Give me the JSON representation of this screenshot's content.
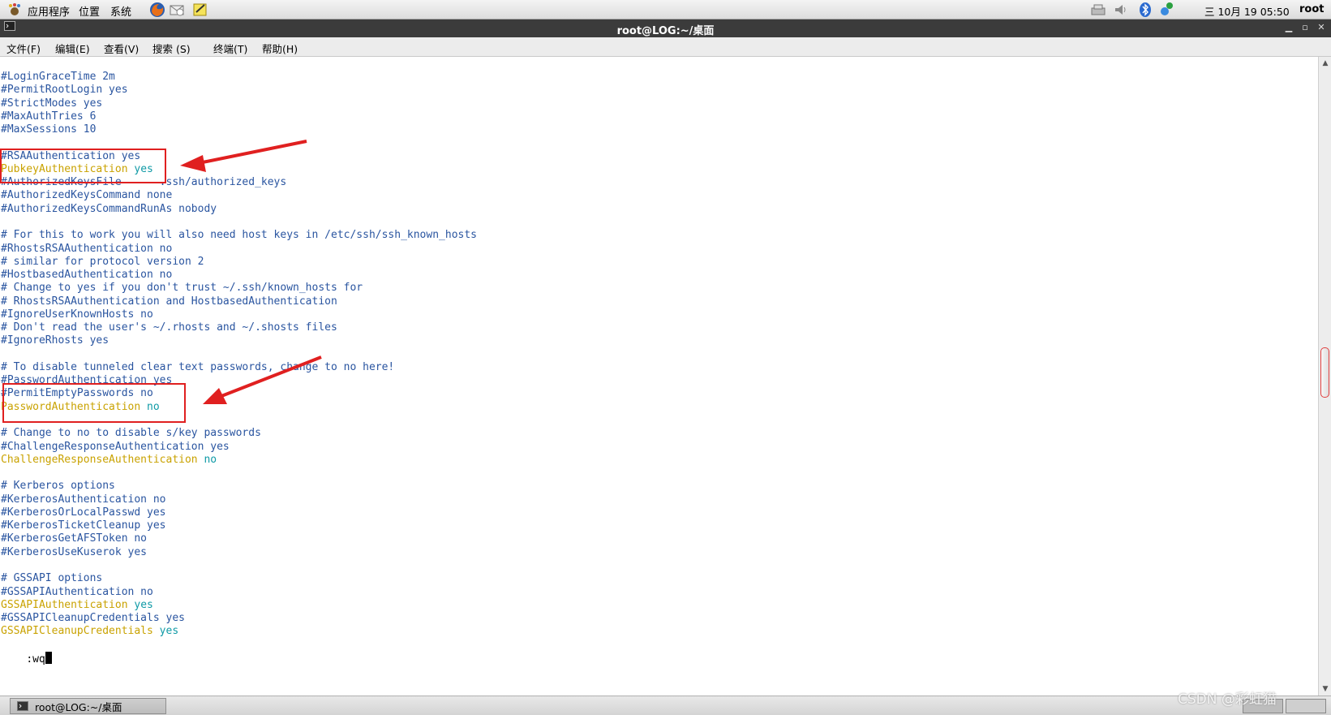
{
  "top_panel": {
    "menus": [
      "应用程序",
      "位置",
      "系统"
    ],
    "clock": "三 10月 19 05:50",
    "user": "root"
  },
  "window": {
    "title": "root@LOG:~/桌面",
    "menu": [
      "文件(F)",
      "编辑(E)",
      "查看(V)",
      "搜索 (S)",
      "终端(T)",
      "帮助(H)"
    ]
  },
  "terminal": {
    "lines": [
      {
        "t": "#LoginGraceTime 2m"
      },
      {
        "t": "#PermitRootLogin yes"
      },
      {
        "t": "#StrictModes yes"
      },
      {
        "t": "#MaxAuthTries 6"
      },
      {
        "t": "#MaxSessions 10"
      },
      {
        "t": ""
      },
      {
        "t": "#RSAAuthentication yes"
      },
      {
        "k": "PubkeyAuthentication",
        "v": "yes"
      },
      {
        "t": "#AuthorizedKeysFile      .ssh/authorized_keys"
      },
      {
        "t": "#AuthorizedKeysCommand none"
      },
      {
        "t": "#AuthorizedKeysCommandRunAs nobody"
      },
      {
        "t": ""
      },
      {
        "t": "# For this to work you will also need host keys in /etc/ssh/ssh_known_hosts"
      },
      {
        "t": "#RhostsRSAAuthentication no"
      },
      {
        "t": "# similar for protocol version 2"
      },
      {
        "t": "#HostbasedAuthentication no"
      },
      {
        "t": "# Change to yes if you don't trust ~/.ssh/known_hosts for"
      },
      {
        "t": "# RhostsRSAAuthentication and HostbasedAuthentication"
      },
      {
        "t": "#IgnoreUserKnownHosts no"
      },
      {
        "t": "# Don't read the user's ~/.rhosts and ~/.shosts files"
      },
      {
        "t": "#IgnoreRhosts yes"
      },
      {
        "t": ""
      },
      {
        "t": "# To disable tunneled clear text passwords, change to no here!"
      },
      {
        "t": "#PasswordAuthentication yes"
      },
      {
        "t": "#PermitEmptyPasswords no"
      },
      {
        "k": "PasswordAuthentication",
        "v": "no"
      },
      {
        "t": ""
      },
      {
        "t": "# Change to no to disable s/key passwords"
      },
      {
        "t": "#ChallengeResponseAuthentication yes"
      },
      {
        "k": "ChallengeResponseAuthentication",
        "v": "no"
      },
      {
        "t": ""
      },
      {
        "t": "# Kerberos options"
      },
      {
        "t": "#KerberosAuthentication no"
      },
      {
        "t": "#KerberosOrLocalPasswd yes"
      },
      {
        "t": "#KerberosTicketCleanup yes"
      },
      {
        "t": "#KerberosGetAFSToken no"
      },
      {
        "t": "#KerberosUseKuserok yes"
      },
      {
        "t": ""
      },
      {
        "t": "# GSSAPI options"
      },
      {
        "t": "#GSSAPIAuthentication no"
      },
      {
        "k": "GSSAPIAuthentication",
        "v": "yes"
      },
      {
        "t": "#GSSAPICleanupCredentials yes"
      },
      {
        "k": "GSSAPICleanupCredentials",
        "v": "yes"
      }
    ],
    "command": ":wq"
  },
  "taskbar": {
    "task_label": "root@LOG:~/桌面"
  },
  "watermark": "CSDN @彩虹猫",
  "colors": {
    "comment": "#2a55a0",
    "keyword": "#c9a200",
    "value": "#0f9aa6",
    "annotation": "#e02020",
    "title_bar": "#3b3b3b"
  }
}
